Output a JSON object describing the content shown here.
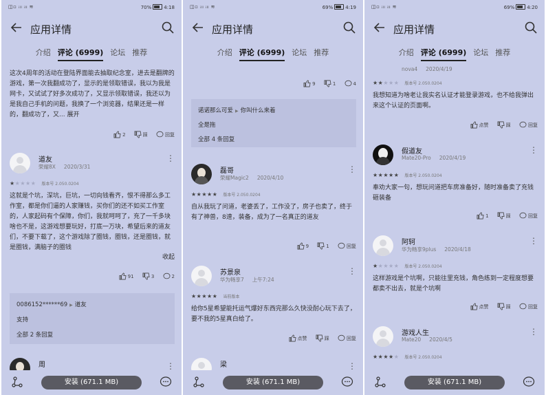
{
  "app": {
    "title": "应用详情",
    "tabs": [
      "介绍",
      "评论 (6999)",
      "论坛",
      "推荐"
    ],
    "install_label": "安装 (671.1 MB)"
  },
  "panels": [
    {
      "status": {
        "signal": "◫▫ ᵢₗₗ ᵢₗₗ ≋",
        "battery": "70%",
        "time": "4:18"
      },
      "top_text": "这次4周年的活动在登陆界面能去抽取纪念室，进去是翻牌的游戏，第一次我翻成功了，显示的是领取错误，我以为我是网卡，又试试了好多次成功了，又显示领取错误，我还以为是我自己手机的问题，我换了一个浏览器，结果还是一样的，翻成功了，又...",
      "expand": "展开",
      "top_actions": {
        "like": "2",
        "dislike": "踩",
        "reply": "回复"
      },
      "reviewer": {
        "name": "道友",
        "device": "荣耀8X",
        "date": "2020/3/31",
        "stars": 1,
        "version": "版本号 2.050.0204"
      },
      "review_text": "这就是个坑，深坑，巨坑，一切向钱看齐，恨不得那么多工作室，都是你们逼的人家赚钱，买你们的还不如买工作室的，人家起码有个保障，你们，我就呵呵了，充了一千多块啥也不是，这游戏想要玩好，打底一万块，希望后来的道友们，不要下载了，这个游戏除了圈钱，圈钱，还是圈钱，就是圈钱，满脑子的圈钱",
      "collapse": "收起",
      "actions": {
        "like": "91",
        "dislike": "3",
        "reply": "2"
      },
      "replies": {
        "line1_user": "0086152******69",
        "line1_target": "道友",
        "line2": "支持",
        "line3": "全部 2 条回复"
      },
      "next_name": "周"
    },
    {
      "status": {
        "signal": "◫▫ ᵢₗₗ ᵢₗₗ ≋",
        "battery": "69%",
        "time": "4:19"
      },
      "top_actions": {
        "like": "9",
        "dislike": "1",
        "reply": "4"
      },
      "replies": {
        "line1_user": "诺诺那么可爱",
        "line1_target": "你叫什么来着",
        "line2": "全是拖",
        "line3": "全部 4 条回复"
      },
      "reviewer": {
        "name": "磊哥",
        "device": "荣耀Magic2",
        "date": "2020/4/10",
        "stars": 5,
        "version": "版本号 2.050.0204"
      },
      "review_text": "自从我玩了问道，老婆丢了，工作没了，房子也卖了，终于有了神兽，8速，装备，成为了一名真正的道友",
      "actions": {
        "like": "9",
        "dislike": "1",
        "reply": "回复"
      },
      "reviewer2": {
        "name": "苏景泉",
        "device": "华为畅享7",
        "date": "上午7:24",
        "stars": 5,
        "version": "当前版本"
      },
      "review_text2": "给你5星希望能托运气爆好东西完那么久快没耐心玩下去了，要不我的5星真白给了。",
      "actions2": {
        "like": "点赞",
        "dislike": "踩",
        "reply": "回复"
      },
      "next_name": "梁"
    },
    {
      "status": {
        "signal": "◫▫ ᵢₗₗ ᵢₗₗ ≋",
        "battery": "69%",
        "time": "4:20"
      },
      "partial_meta": {
        "device": "nova4",
        "date": "2020/4/19"
      },
      "partial_stars": 2,
      "partial_version": "版本号 2.050.0204",
      "partial_text": "我想知道为啥老让我实名认证才能登录游戏，也不给我弹出来这个认证的页面啊。",
      "partial_actions": {
        "like": "点赞",
        "dislike": "踩",
        "reply": "回复"
      },
      "reviewer": {
        "name": "假道友",
        "device": "Mate20-Pro",
        "date": "2020/4/19",
        "stars": 5,
        "version": "版本号 2.050.0204"
      },
      "review_text": "奉劝大家一句，想玩问道把车房准备好，随时准备卖了充钱砸装备",
      "actions": {
        "like": "1",
        "dislike": "踩",
        "reply": "回复"
      },
      "reviewer2": {
        "name": "阿轲",
        "device": "华为畅享9plus",
        "date": "2020/4/18",
        "stars": 1,
        "version": "版本号 2.050.0204"
      },
      "review_text2": "这样游戏是个坑啊，只能往里充钱，角色练到一定程度想要都卖不出去，就是个坑啊",
      "actions2": {
        "like": "点赞",
        "dislike": "踩",
        "reply": "回复"
      },
      "reviewer3": {
        "name": "游戏人生",
        "device": "Mate20",
        "date": "2020/4/5",
        "stars": 4,
        "version": "版本号 2.050.0204"
      }
    }
  ]
}
